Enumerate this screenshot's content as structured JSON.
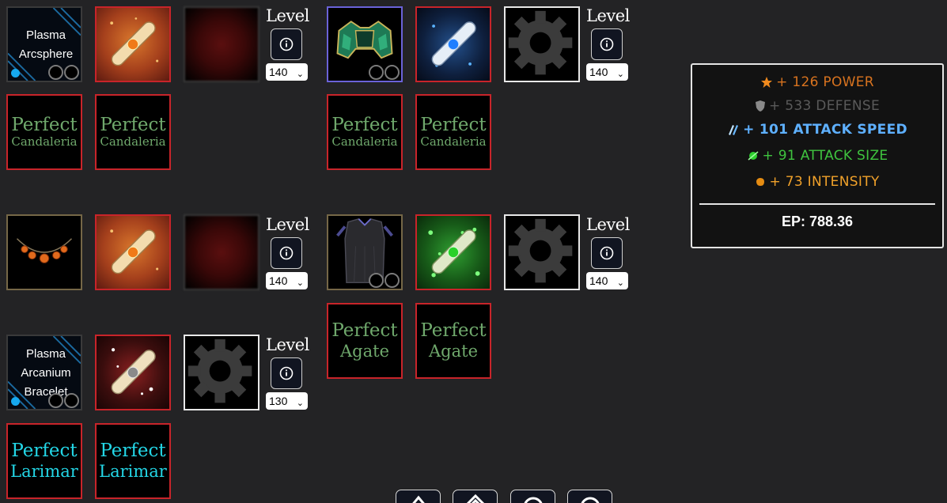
{
  "items": {
    "plasma_arcsphere": "Plasma Arcsphere",
    "plasma_arcanium_bracelet": "Plasma Arcanium Bracelet"
  },
  "level_label": "Level",
  "level_selects": [
    "140",
    "140",
    "140",
    "140",
    "130"
  ],
  "gems": {
    "perfect": "Perfect",
    "candaleria": "Candaleria",
    "agate": "Agate",
    "larimar": "Larimar"
  },
  "stats": {
    "power": "+ 126 POWER",
    "defense": "+ 533 DEFENSE",
    "attack_speed": "+ 101 ATTACK SPEED",
    "attack_size": "+ 91 ATTACK SIZE",
    "intensity": "+ 73 INTENSITY",
    "ep": "EP: 788.36"
  },
  "colors": {
    "power": "#d8731f",
    "defense": "#5a5a5a",
    "attack_speed": "#5eb0ff",
    "attack_size": "#3fc43f",
    "intensity": "#f0a12a"
  },
  "icons": {
    "info": "info-icon",
    "gear": "gear-placeholder-icon",
    "dropdown": "chevron-down-icon"
  }
}
